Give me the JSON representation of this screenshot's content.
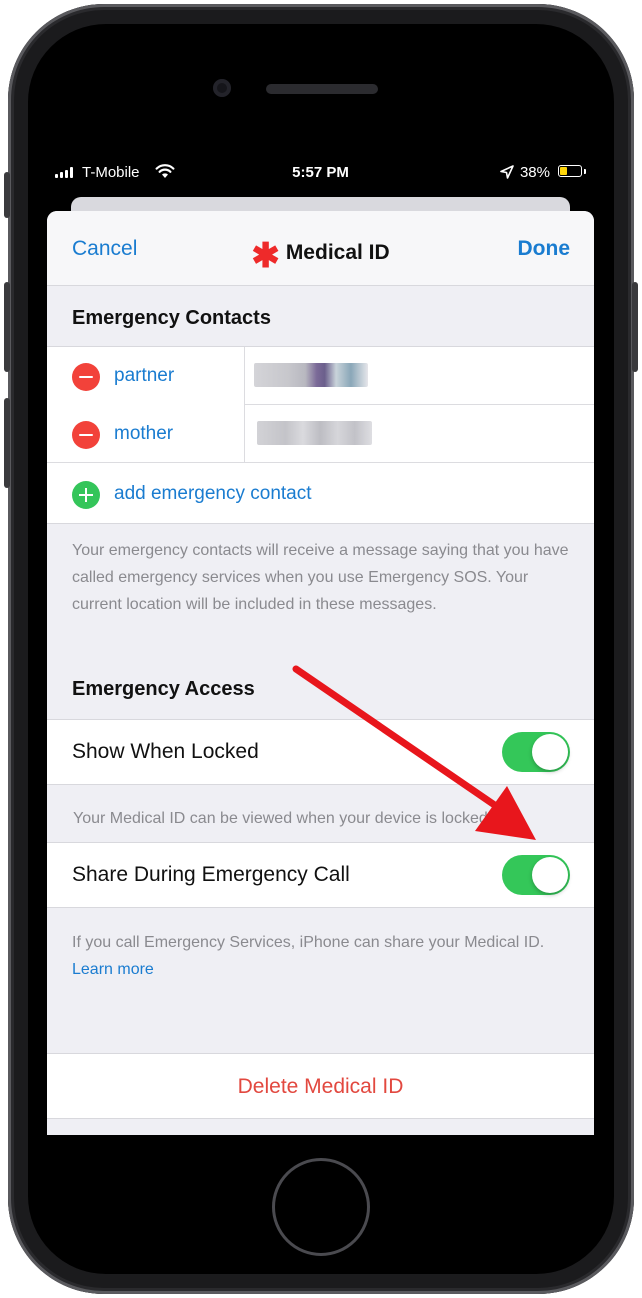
{
  "status_bar": {
    "carrier": "T-Mobile",
    "time": "5:57 PM",
    "battery_percent": "38%",
    "battery_level": 0.38,
    "icons": [
      "signal-icon",
      "wifi-icon",
      "location-arrow-icon",
      "battery-charging-icon"
    ]
  },
  "nav": {
    "cancel_label": "Cancel",
    "title_icon": "✱",
    "title": "Medical ID",
    "done_label": "Done"
  },
  "emergency_contacts": {
    "header": "Emergency Contacts",
    "contacts": [
      {
        "relationship": "partner"
      },
      {
        "relationship": "mother"
      }
    ],
    "add_label": "add emergency contact",
    "footnote": "Your emergency contacts will receive a message saying that you have called emergency services when you use Emergency SOS. Your current location will be included in these messages."
  },
  "emergency_access": {
    "header": "Emergency Access",
    "show_when_locked": {
      "label": "Show When Locked",
      "enabled": true
    },
    "show_when_locked_footnote": "Your Medical ID can be viewed when your device is locked",
    "share_during_call": {
      "label": "Share During Emergency Call",
      "enabled": true
    },
    "share_footnote": "If you call Emergency Services, iPhone can share your Medical ID.",
    "learn_more_label": "Learn more"
  },
  "delete_label": "Delete Medical ID",
  "colors": {
    "accent": "#1a7cd0",
    "destructive": "#e2483f",
    "toggle_on": "#34c759",
    "annotation_arrow": "#e8161c"
  }
}
